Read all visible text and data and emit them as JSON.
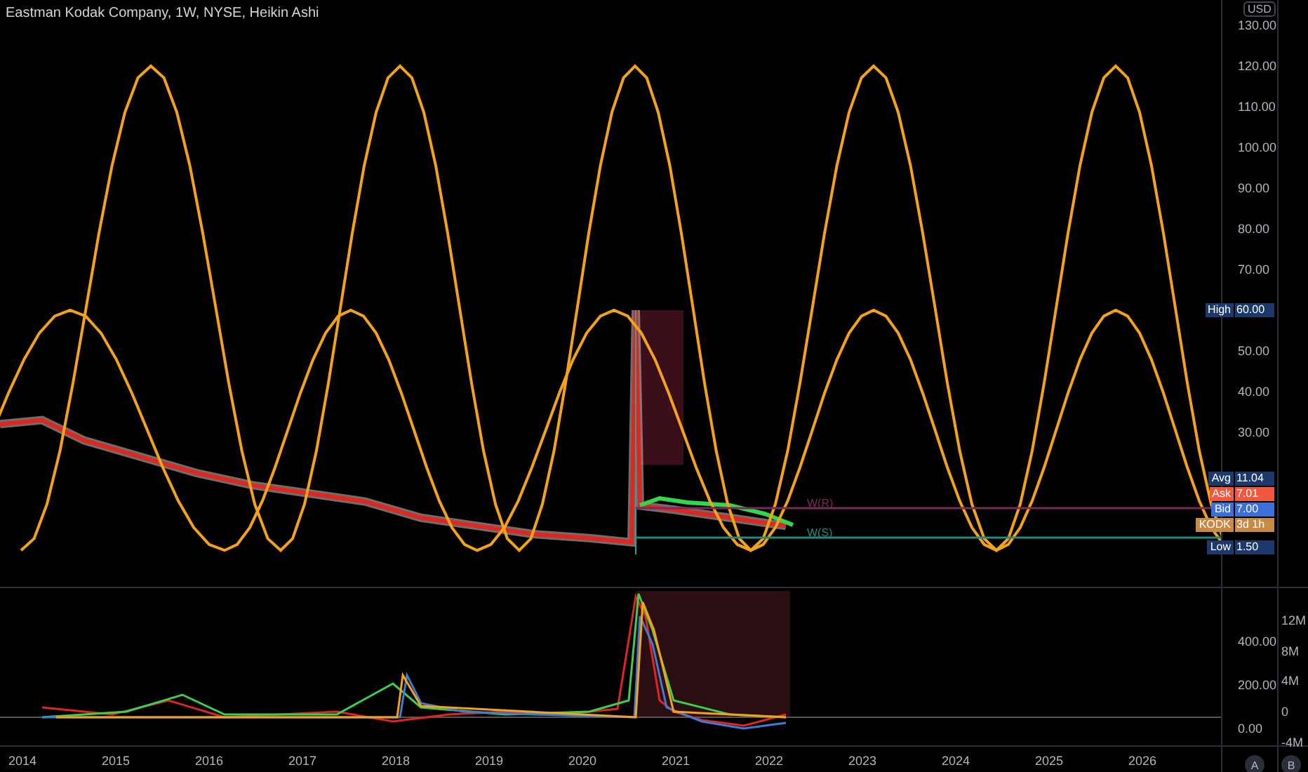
{
  "title": "Eastman Kodak Company, 1W, NYSE, Heikin Ashi",
  "currency": "USD",
  "price_ticks": [
    "130.00",
    "120.00",
    "110.00",
    "100.00",
    "90.00",
    "80.00",
    "70.00",
    "50.00",
    "40.00",
    "30.00"
  ],
  "price_tags": [
    {
      "label": "High",
      "value": "60.00",
      "kind": "high"
    },
    {
      "label": "Avg",
      "value": "11.04",
      "kind": "avg"
    },
    {
      "label": "Ask",
      "value": "7.01",
      "kind": "ask"
    },
    {
      "label": "Bid",
      "value": "7.00",
      "kind": "bid"
    },
    {
      "label": "KODK",
      "value": "3d 1h",
      "kind": "symbol"
    },
    {
      "label": "Low",
      "value": "1.50",
      "kind": "low"
    }
  ],
  "levels": [
    {
      "label": "W(R)",
      "kind": "resistance"
    },
    {
      "label": "W(S)",
      "kind": "support"
    }
  ],
  "oscillator_ticks": [
    "400.00",
    "200.00",
    "0.00"
  ],
  "volume_ticks": [
    "12M",
    "8M",
    "4M",
    "0",
    "-4M"
  ],
  "time_axis": [
    "2014",
    "2015",
    "2016",
    "2017",
    "2018",
    "2019",
    "2020",
    "2021",
    "2022",
    "2023",
    "2024",
    "2025",
    "2026"
  ],
  "scale_buttons": [
    "A",
    "B"
  ]
}
